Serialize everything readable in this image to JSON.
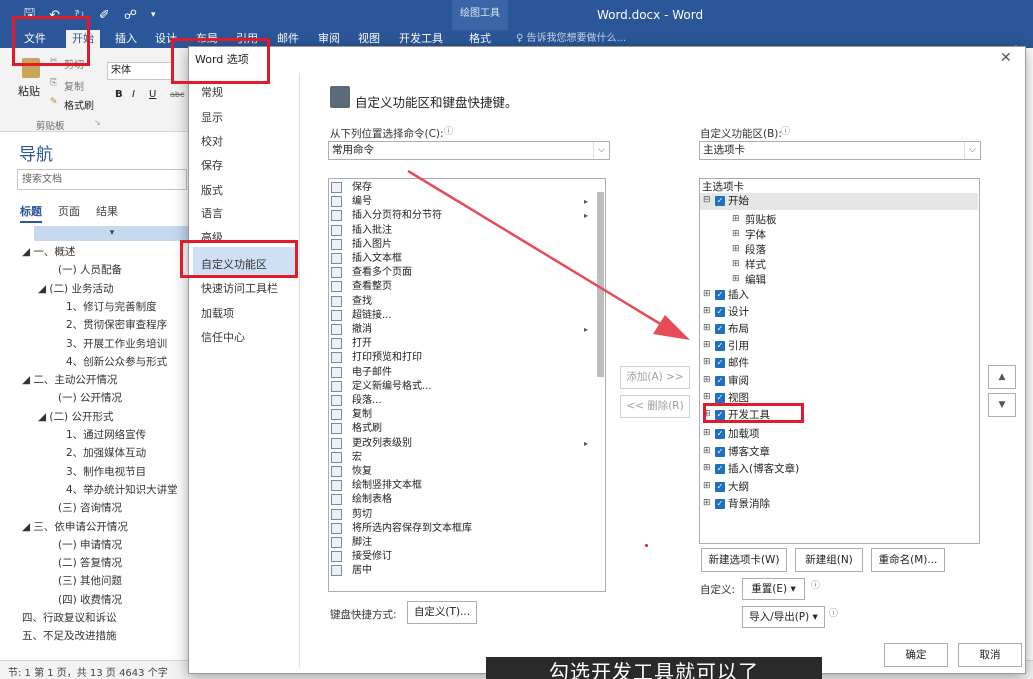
{
  "titlebar": {
    "context_tab": "绘图工具",
    "doc_title": "Word.docx - Word",
    "qat_icons": [
      "save-icon",
      "undo-icon",
      "redo-icon",
      "format-painter-icon",
      "touch-mode-icon",
      "customize-qat-icon"
    ]
  },
  "ribbon_tabs": {
    "file": "文件",
    "home": "开始",
    "insert": "插入",
    "design": "设计",
    "layout": "布局",
    "references": "引用",
    "mailings": "邮件",
    "review": "审阅",
    "view": "视图",
    "developer": "开发工具",
    "format": "格式",
    "tell_me": "♀ 告诉我您想要做什么..."
  },
  "watermark": "小黑课堂",
  "ribbon": {
    "paste": "粘贴",
    "cut": "剪切",
    "copy": "复制",
    "format_painter": "格式刷",
    "clipboard": "剪贴板",
    "font": "宋体",
    "bold": "B",
    "italic": "I",
    "underline": "U",
    "abc": "abc"
  },
  "nav": {
    "title": "导航",
    "search_placeholder": "搜索文档",
    "tabs": [
      "标题",
      "页面",
      "结果"
    ],
    "collapse_glyph": "▾",
    "tree": [
      {
        "text": "◢ 一、概述",
        "level": 0
      },
      {
        "text": "(一) 人员配备",
        "level": 1
      },
      {
        "text": "◢ (二) 业务活动",
        "level": 1
      },
      {
        "text": "1、修订与完善制度",
        "level": 2
      },
      {
        "text": "2、贯彻保密审查程序",
        "level": 2
      },
      {
        "text": "3、开展工作业务培训",
        "level": 2
      },
      {
        "text": "4、创新公众参与形式",
        "level": 2
      },
      {
        "text": "◢ 二、主动公开情况",
        "level": 0
      },
      {
        "text": "(一) 公开情况",
        "level": 1
      },
      {
        "text": "◢ (二) 公开形式",
        "level": 1
      },
      {
        "text": "1、通过网络宣传",
        "level": 2
      },
      {
        "text": "2、加强媒体互动",
        "level": 2
      },
      {
        "text": "3、制作电视节目",
        "level": 2
      },
      {
        "text": "4、举办统计知识大讲堂",
        "level": 2
      },
      {
        "text": "(三) 咨询情况",
        "level": 1
      },
      {
        "text": "◢ 三、依申请公开情况",
        "level": 0
      },
      {
        "text": "(一) 申请情况",
        "level": 1
      },
      {
        "text": "(二) 答复情况",
        "level": 1
      },
      {
        "text": "(三) 其他问题",
        "level": 1
      },
      {
        "text": "(四) 收费情况",
        "level": 1
      },
      {
        "text": "四、行政复议和诉讼",
        "level": 0
      },
      {
        "text": "五、不足及改进措施",
        "level": 0
      }
    ]
  },
  "status": {
    "text": "节: 1   第 1 页，共 13 页   4643 个字"
  },
  "dialog": {
    "title": "Word 选项",
    "close": "✕",
    "categories": [
      "常规",
      "显示",
      "校对",
      "保存",
      "版式",
      "语言",
      "高级",
      "自定义功能区",
      "快速访问工具栏",
      "加载项",
      "信任中心"
    ],
    "selected_category": "自定义功能区",
    "header": "自定义功能区和键盘快捷键。",
    "choose_from_label": "从下列位置选择命令(C):",
    "choose_from_value": "常用命令",
    "customize_label": "自定义功能区(B):",
    "customize_value": "主选项卡",
    "commands": [
      {
        "text": "保存",
        "sub": false
      },
      {
        "text": "编号",
        "sub": true
      },
      {
        "text": "插入分页符和分节符",
        "sub": true
      },
      {
        "text": "插入批注",
        "sub": false
      },
      {
        "text": "插入图片",
        "sub": false
      },
      {
        "text": "插入文本框",
        "sub": false
      },
      {
        "text": "查看多个页面",
        "sub": false
      },
      {
        "text": "查看整页",
        "sub": false
      },
      {
        "text": "查找",
        "sub": false
      },
      {
        "text": "超链接...",
        "sub": false
      },
      {
        "text": "撤消",
        "sub": true
      },
      {
        "text": "打开",
        "sub": false
      },
      {
        "text": "打印预览和打印",
        "sub": false
      },
      {
        "text": "电子邮件",
        "sub": false
      },
      {
        "text": "定义新编号格式...",
        "sub": false
      },
      {
        "text": "段落...",
        "sub": false
      },
      {
        "text": "复制",
        "sub": false
      },
      {
        "text": "格式刷",
        "sub": false
      },
      {
        "text": "更改列表级别",
        "sub": true
      },
      {
        "text": "宏",
        "sub": false
      },
      {
        "text": "恢复",
        "sub": false
      },
      {
        "text": "绘制竖排文本框",
        "sub": false
      },
      {
        "text": "绘制表格",
        "sub": false
      },
      {
        "text": "剪切",
        "sub": false
      },
      {
        "text": "将所选内容保存到文本框库",
        "sub": false
      },
      {
        "text": "脚注",
        "sub": false
      },
      {
        "text": "接受修订",
        "sub": false
      },
      {
        "text": "居中",
        "sub": false
      }
    ],
    "add_button": "添加(A) >>",
    "remove_button": "<< 删除(R)",
    "tabs_root": "主选项卡",
    "tabs": [
      {
        "text": "开始",
        "expanded": true,
        "highlighted": true
      },
      {
        "text": "剪贴板",
        "group": true
      },
      {
        "text": "字体",
        "group": true
      },
      {
        "text": "段落",
        "group": true
      },
      {
        "text": "样式",
        "group": true
      },
      {
        "text": "编辑",
        "group": true
      },
      {
        "text": "插入"
      },
      {
        "text": "设计"
      },
      {
        "text": "布局"
      },
      {
        "text": "引用"
      },
      {
        "text": "邮件"
      },
      {
        "text": "审阅"
      },
      {
        "text": "视图"
      },
      {
        "text": "开发工具"
      },
      {
        "text": "加载项"
      },
      {
        "text": "博客文章"
      },
      {
        "text": "插入(博客文章)"
      },
      {
        "text": "大纲"
      },
      {
        "text": "背景消除"
      }
    ],
    "new_tab": "新建选项卡(W)",
    "new_group": "新建组(N)",
    "rename": "重命名(M)...",
    "customizations_label": "自定义:",
    "reset": "重置(E) ▾",
    "import_export": "导入/导出(P) ▾",
    "keyboard_label": "键盘快捷方式:",
    "keyboard_button": "自定义(T)...",
    "ok": "确定",
    "cancel": "取消",
    "move_up": "▲",
    "move_down": "▼",
    "info": "ⓘ"
  },
  "subtitle": "勾选开发工具就可以了",
  "colors": {
    "word_blue": "#2b579a",
    "highlight_red": "#e21b2b",
    "checkbox_blue": "#1f6fc2",
    "selected_bg": "#cfe0f4"
  }
}
